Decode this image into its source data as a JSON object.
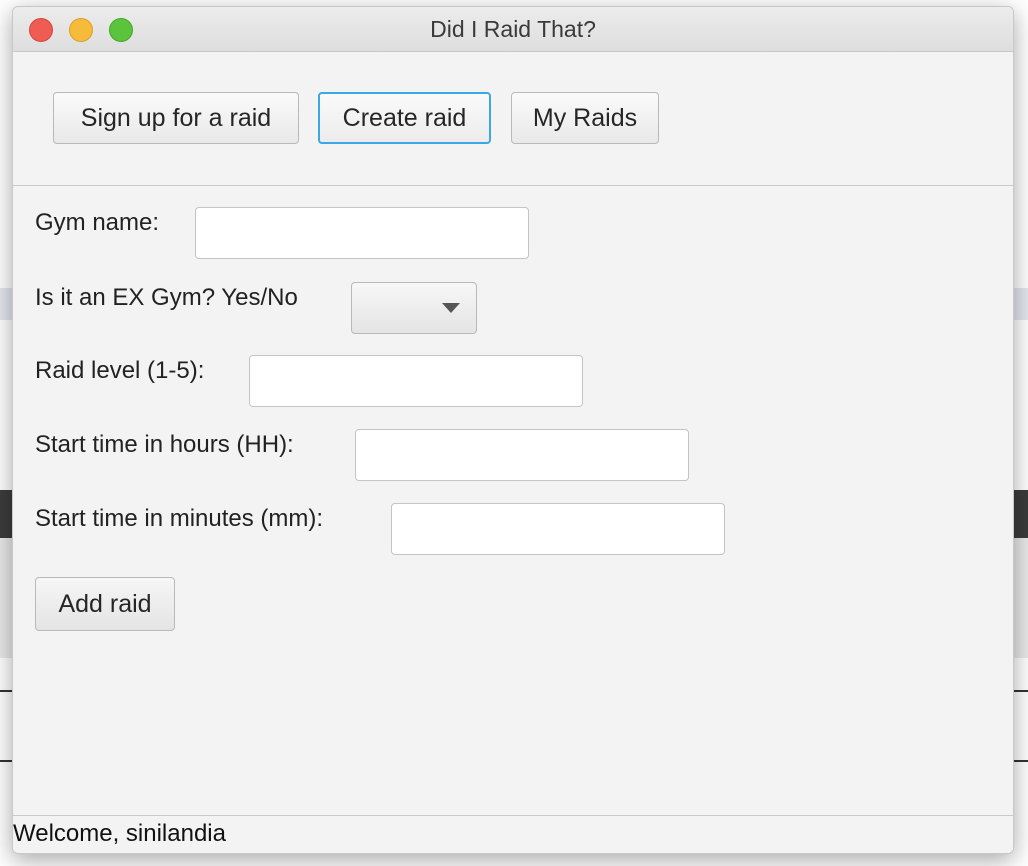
{
  "window": {
    "title": "Did I Raid That?"
  },
  "nav": {
    "signup_label": "Sign up for a raid",
    "create_label": "Create raid",
    "myraids_label": "My Raids",
    "active": "create"
  },
  "form": {
    "gym_name_label": "Gym name:",
    "gym_name_value": "",
    "ex_gym_label": "Is it an EX Gym? Yes/No",
    "ex_gym_selected": "",
    "raid_level_label": "Raid level (1-5):",
    "raid_level_value": "",
    "start_hours_label": "Start time in hours (HH):",
    "start_hours_value": "",
    "start_minutes_label": "Start time in minutes (mm):",
    "start_minutes_value": "",
    "add_button_label": "Add raid"
  },
  "status": {
    "text": "Welcome, sinilandia"
  },
  "colors": {
    "focus_ring": "#3aa7e6",
    "close": "#ee5c54",
    "minimize": "#f6bb3a",
    "maximize": "#5cc43c"
  }
}
